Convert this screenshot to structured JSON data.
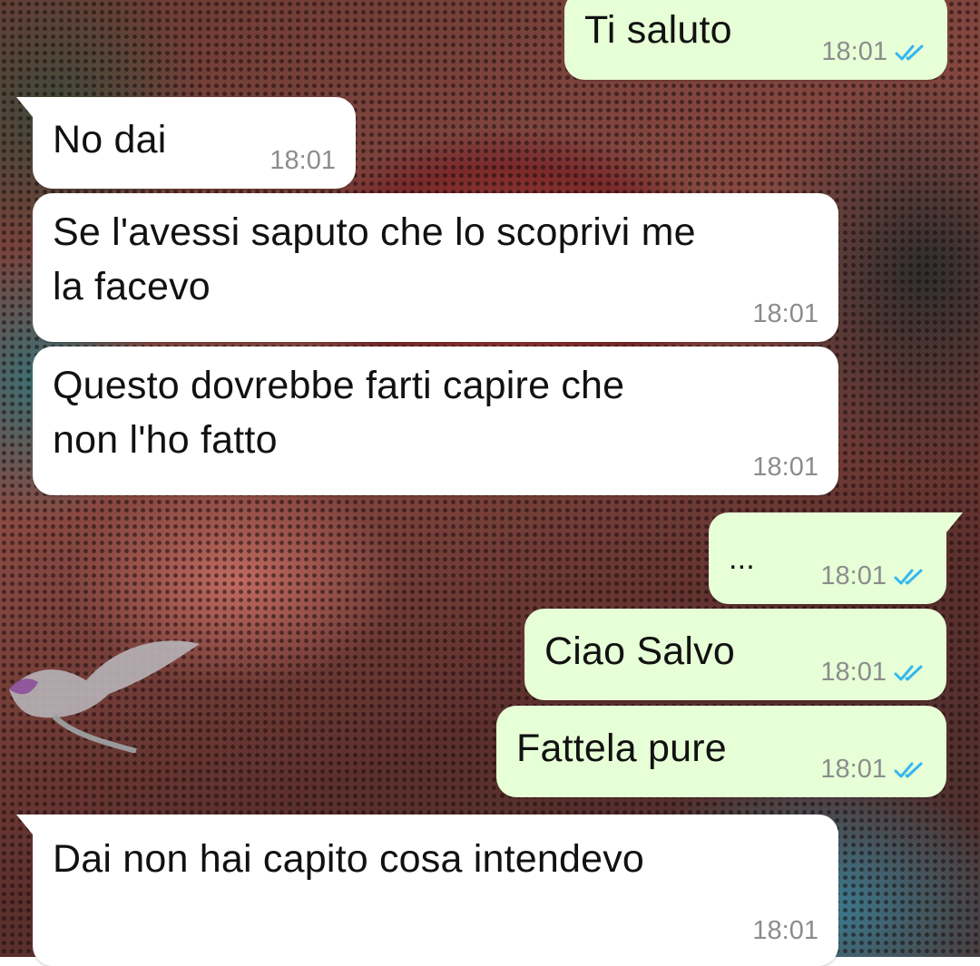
{
  "chat": {
    "messages": [
      {
        "direction": "out",
        "text": "Ti saluto",
        "time": "18:01",
        "status": "read"
      },
      {
        "direction": "in",
        "text": "No dai",
        "time": "18:01"
      },
      {
        "direction": "in",
        "text_lines": [
          "Se l'avessi saputo che lo scoprivi me",
          "la facevo"
        ],
        "time": "18:01"
      },
      {
        "direction": "in",
        "text_lines": [
          "Questo dovrebbe farti capire che",
          "non l'ho fatto"
        ],
        "time": "18:01"
      },
      {
        "direction": "out",
        "text": "...",
        "time": "18:01",
        "status": "read"
      },
      {
        "direction": "out",
        "text": "Ciao Salvo",
        "time": "18:01",
        "status": "read"
      },
      {
        "direction": "out",
        "text": "Fattela pure",
        "time": "18:01",
        "status": "read"
      },
      {
        "direction": "in",
        "text": "Dai non hai capito cosa intendevo",
        "time": "18:01"
      }
    ]
  },
  "colors": {
    "incoming_bubble": "#ffffff",
    "outgoing_bubble": "#e6ffd6",
    "timestamp": "#8c8c8c",
    "read_ticks": "#34b7f1"
  },
  "icons": {
    "read_receipt": "double-check-icon"
  }
}
